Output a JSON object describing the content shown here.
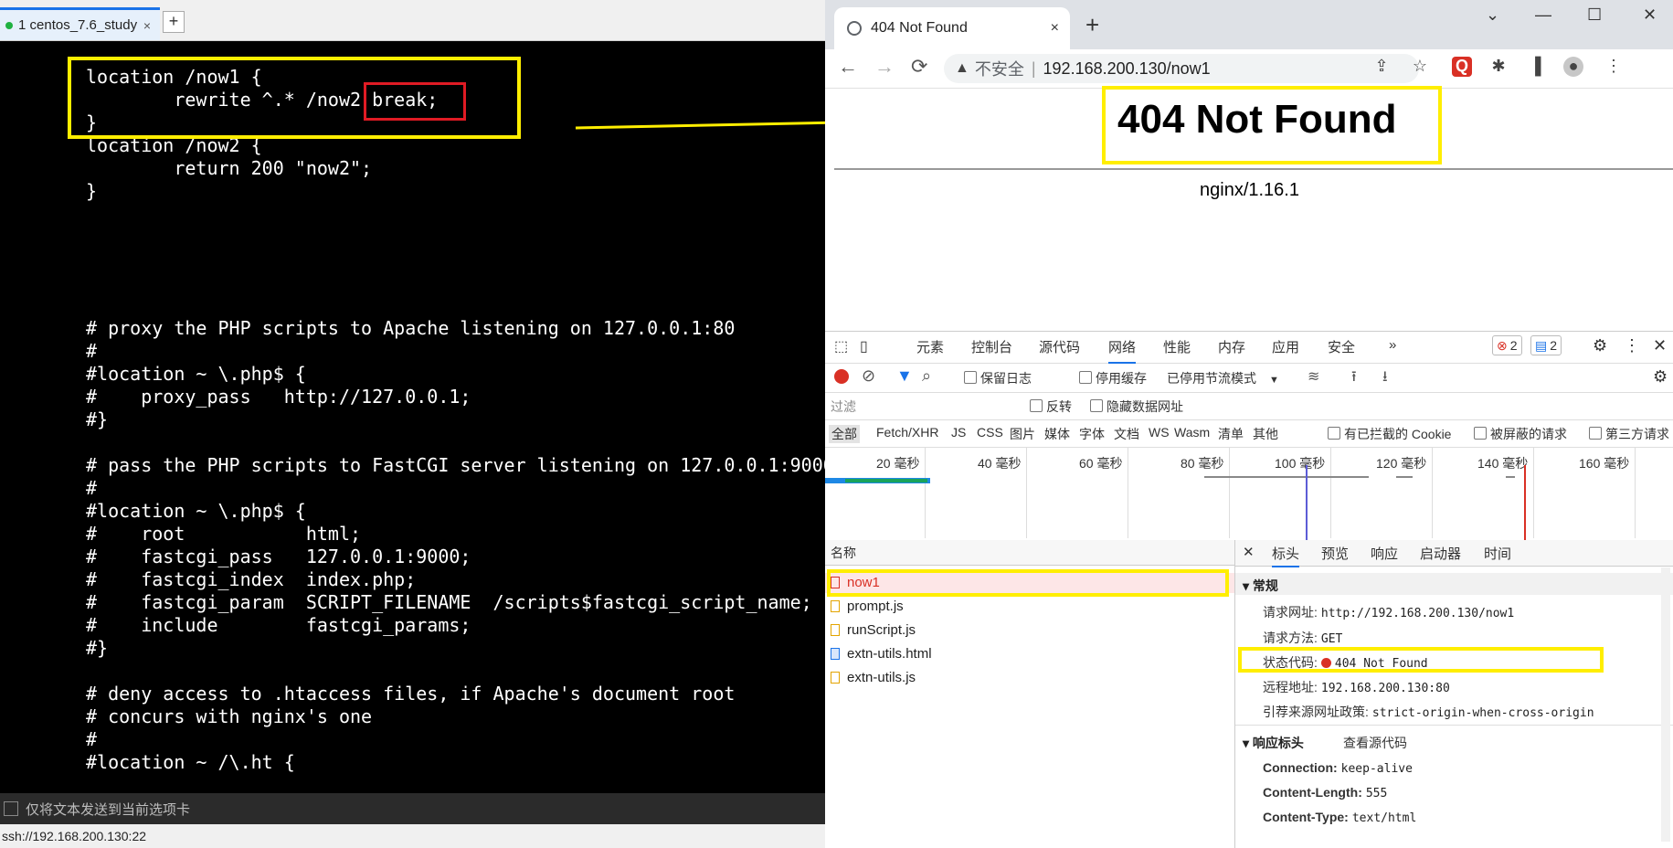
{
  "terminal": {
    "tab_label": "1 centos_7.6_study",
    "tab_close": "×",
    "new_tab": "+",
    "code": "location /now1 {\n        rewrite ^.* /now2 break;\n}\nlocation /now2 {\n        return 200 \"now2\";\n}\n\n\n\n\n\n# proxy the PHP scripts to Apache listening on 127.0.0.1:80\n#\n#location ~ \\.php$ {\n#    proxy_pass   http://127.0.0.1;\n#}\n\n# pass the PHP scripts to FastCGI server listening on 127.0.0.1:9000\n#\n#location ~ \\.php$ {\n#    root           html;\n#    fastcgi_pass   127.0.0.1:9000;\n#    fastcgi_index  index.php;\n#    fastcgi_param  SCRIPT_FILENAME  /scripts$fastcgi_script_name;\n#    include        fastcgi_params;\n#}\n\n# deny access to .htaccess files, if Apache's document root\n# concurs with nginx's one\n#\n#location ~ /\\.ht {",
    "input_placeholder": "仅将文本发送到当前选项卡",
    "status": "ssh://192.168.200.130:22"
  },
  "browser": {
    "tab_title": "404 Not Found",
    "tab_close": "×",
    "new_tab": "+",
    "window": {
      "minimize": "⌄",
      "restore": "—",
      "maximize": "☐",
      "close": "✕"
    },
    "nav": {
      "back": "←",
      "forward": "→",
      "reload": "⟳"
    },
    "address": {
      "warning_icon": "▲",
      "insecure_label": "不安全",
      "separator": "|",
      "url": "192.168.200.130/now1"
    },
    "page": {
      "heading": "404 Not Found",
      "server": "nginx/1.16.1"
    }
  },
  "devtools": {
    "panels": [
      "元素",
      "控制台",
      "源代码",
      "网络",
      "性能",
      "内存",
      "应用",
      "安全"
    ],
    "more": "»",
    "error_count": "2",
    "message_count": "2",
    "toolbar": {
      "preserve_log": "保留日志",
      "disable_cache": "停用缓存",
      "throttle": "已停用节流模式"
    },
    "filter": {
      "placeholder": "过滤",
      "invert": "反转",
      "hide_data_urls": "隐藏数据网址"
    },
    "types": [
      "全部",
      "Fetch/XHR",
      "JS",
      "CSS",
      "图片",
      "媒体",
      "字体",
      "文档",
      "WS",
      "Wasm",
      "清单",
      "其他"
    ],
    "blocked_cookies": "有已拦截的 Cookie",
    "blocked_requests": "被屏蔽的请求",
    "third_party": "第三方请求",
    "timeline_ticks": [
      "20 毫秒",
      "40 毫秒",
      "60 毫秒",
      "80 毫秒",
      "100 毫秒",
      "120 毫秒",
      "140 毫秒",
      "160 毫秒"
    ],
    "list_header": "名称",
    "requests": [
      "now1",
      "prompt.js",
      "runScript.js",
      "extn-utils.html",
      "extn-utils.js"
    ],
    "detail_close": "✕",
    "detail_tabs": [
      "标头",
      "预览",
      "响应",
      "启动器",
      "时间"
    ],
    "general": {
      "title": "常规",
      "request_url_label": "请求网址:",
      "request_url": "http://192.168.200.130/now1",
      "method_label": "请求方法:",
      "method": "GET",
      "status_label": "状态代码:",
      "status": "404 Not Found",
      "remote_label": "远程地址:",
      "remote": "192.168.200.130:80",
      "referrer_label": "引荐来源网址政策:",
      "referrer": "strict-origin-when-cross-origin"
    },
    "response_headers": {
      "title": "响应标头",
      "view_source": "查看源代码",
      "connection_label": "Connection:",
      "connection": "keep-alive",
      "length_label": "Content-Length:",
      "length": "555",
      "type_label": "Content-Type:",
      "type": "text/html"
    }
  },
  "colors": {
    "annotation_yellow": "#ffee00",
    "annotation_red": "#e01b24",
    "error_red": "#d93025",
    "accent_blue": "#1a73e8"
  }
}
